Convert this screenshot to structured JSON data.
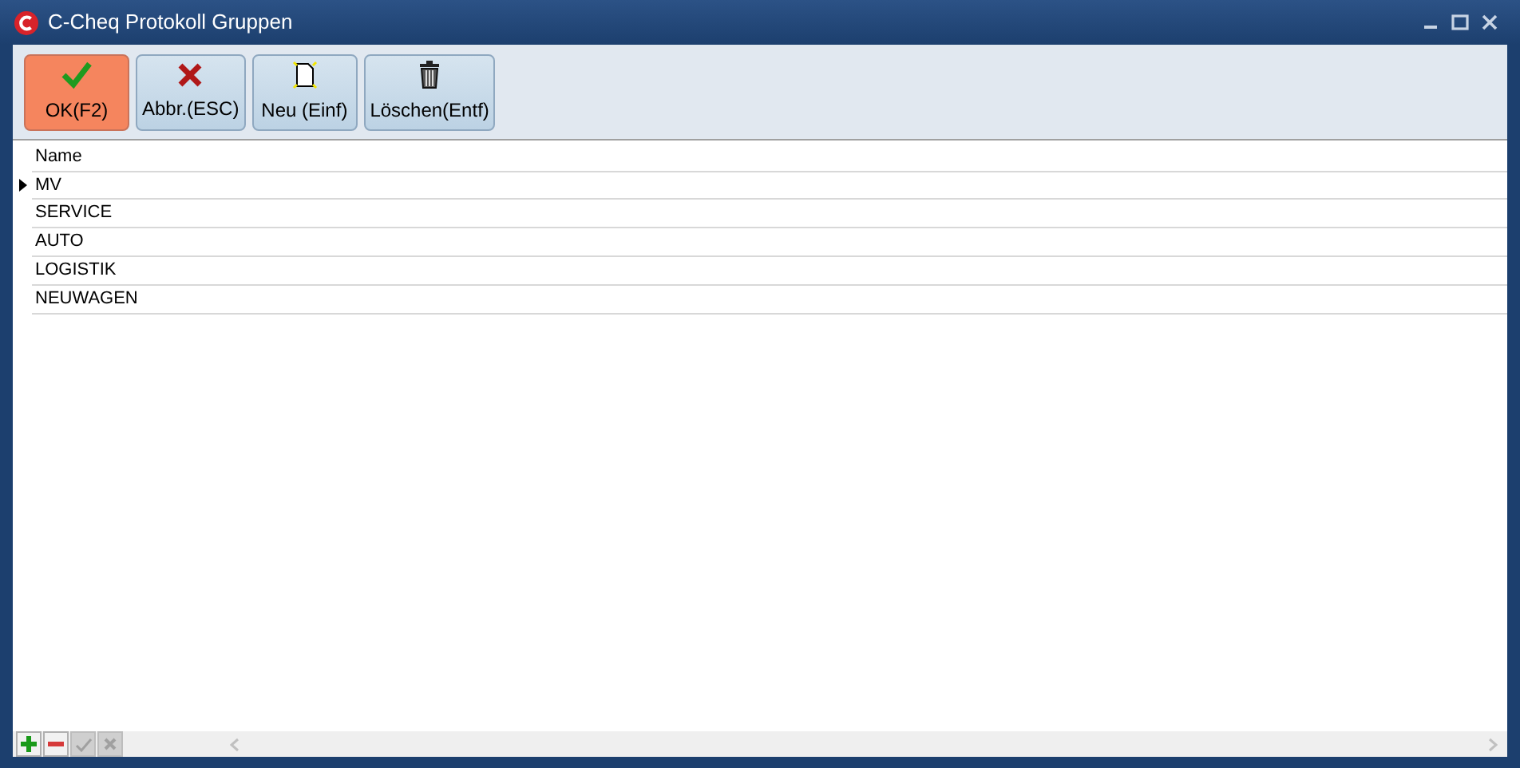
{
  "window": {
    "title": "C-Cheq Protokoll Gruppen"
  },
  "toolbar": [
    {
      "label": "OK(F2)",
      "kind": "ok",
      "selected": true
    },
    {
      "label": "Abbr.(ESC)",
      "kind": "cancel",
      "selected": false
    },
    {
      "label": "Neu (Einf)",
      "kind": "new",
      "selected": false
    },
    {
      "label": "Löschen(Entf)",
      "kind": "delete",
      "selected": false
    }
  ],
  "table": {
    "columns": [
      "Name"
    ],
    "rows": [
      {
        "name": "MV",
        "selected": true
      },
      {
        "name": "SERVICE",
        "selected": false
      },
      {
        "name": "AUTO",
        "selected": false
      },
      {
        "name": "LOGISTIK",
        "selected": false
      },
      {
        "name": "NEUWAGEN",
        "selected": false
      }
    ]
  },
  "navigator": [
    {
      "kind": "add",
      "disabled": false
    },
    {
      "kind": "remove",
      "disabled": false
    },
    {
      "kind": "confirm",
      "disabled": true
    },
    {
      "kind": "cancel",
      "disabled": true
    }
  ]
}
